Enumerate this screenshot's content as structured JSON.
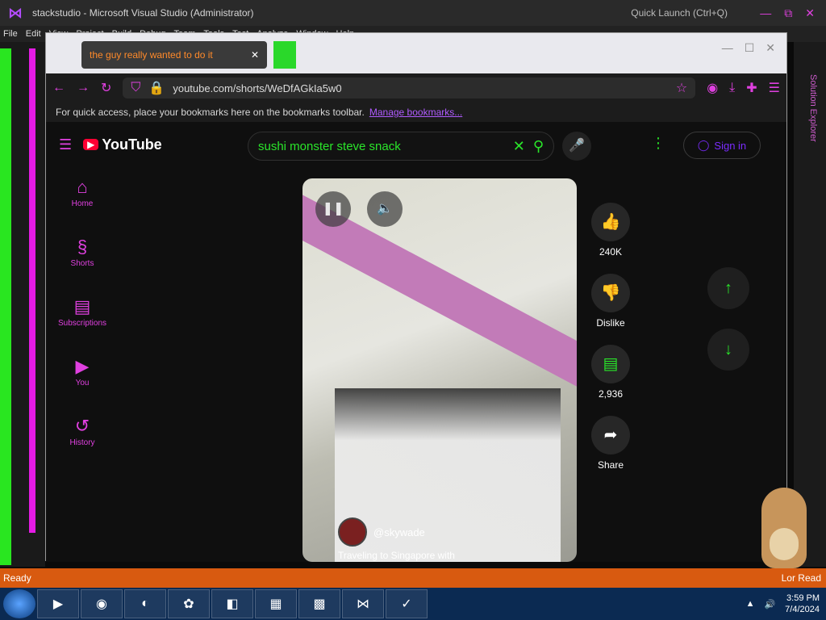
{
  "vs": {
    "title": "stackstudio - Microsoft Visual Studio (Administrator)",
    "search": "Quick Launch (Ctrl+Q)",
    "menu": [
      "File",
      "Edit",
      "View",
      "Project",
      "Build",
      "Debug",
      "Team",
      "Tools",
      "Test",
      "Analyze",
      "Window",
      "Help"
    ],
    "right_panel_label": "Solution Explorer",
    "status_left": "Ready",
    "status_right": "Lor Read"
  },
  "browser": {
    "tab_title": "the guy really wanted to do it",
    "url": "youtube.com/shorts/WeDfAGkIa5w0",
    "bookmarks_text": "For quick access, place your bookmarks here on the bookmarks toolbar.",
    "bookmarks_link": "Manage bookmarks..."
  },
  "youtube": {
    "search_query": "sushi monster steve snack",
    "sign_in": "Sign in",
    "sidebar": [
      {
        "label": "Home",
        "icon": "home-icon",
        "glyph": "⌂"
      },
      {
        "label": "Shorts",
        "icon": "shorts-icon",
        "glyph": "§"
      },
      {
        "label": "Subscriptions",
        "icon": "subscriptions-icon",
        "glyph": "▤"
      },
      {
        "label": "You",
        "icon": "you-icon",
        "glyph": "▶"
      },
      {
        "label": "History",
        "icon": "history-icon",
        "glyph": "↺"
      }
    ],
    "video": {
      "channel": "@skywade",
      "description": "Traveling to Singapore with"
    },
    "actions": {
      "likes": "240K",
      "dislike_label": "Dislike",
      "comments": "2,936",
      "share_label": "Share"
    }
  },
  "taskbar": {
    "time": "3:59 PM",
    "date": "7/4/2024"
  },
  "colors": {
    "accent_magenta": "#e040e0",
    "accent_green": "#2ae52a",
    "statusbar": "#d85a10",
    "taskbar": "#0b2a52"
  }
}
